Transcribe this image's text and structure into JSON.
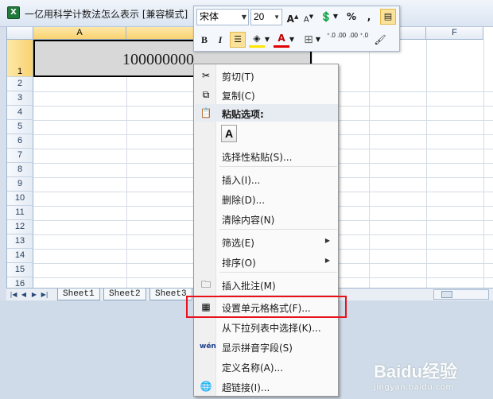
{
  "window": {
    "title": "一亿用科学计数法怎么表示  [兼容模式]",
    "app_icon": "excel-icon"
  },
  "grid": {
    "columns": [
      "A",
      "B",
      "F"
    ],
    "rows": [
      "1",
      "2",
      "3",
      "4",
      "5",
      "6",
      "7",
      "8",
      "9",
      "10",
      "11",
      "12",
      "13",
      "14",
      "15",
      "16"
    ],
    "cell_value": "100000000"
  },
  "sheets": {
    "tabs": [
      "Sheet1",
      "Sheet2",
      "Sheet3"
    ]
  },
  "mini_toolbar": {
    "font_name": "宋体",
    "font_size": "20",
    "percent_label": "%",
    "comma_label": ",",
    "bold_label": "B",
    "italic_label": "I",
    "decrease_decimal_label": "⁺.0 .00",
    "increase_decimal_label": ".00 ⁺.0"
  },
  "context_menu": {
    "cut": "剪切(T)",
    "copy": "复制(C)",
    "paste_options": "粘贴选项:",
    "paste_a": "A",
    "paste_special": "选择性粘贴(S)...",
    "insert": "插入(I)...",
    "delete": "删除(D)...",
    "clear_contents": "清除内容(N)",
    "filter": "筛选(E)",
    "sort": "排序(O)",
    "insert_comment": "插入批注(M)",
    "format_cells": "设置单元格格式(F)...",
    "pick_from_list": "从下拉列表中选择(K)...",
    "show_phonetic": "显示拼音字段(S)",
    "define_name": "定义名称(A)...",
    "hyperlink": "超链接(I)..."
  },
  "watermark": {
    "brand": "Baidu经验",
    "url": "jingyan.baidu.com"
  }
}
